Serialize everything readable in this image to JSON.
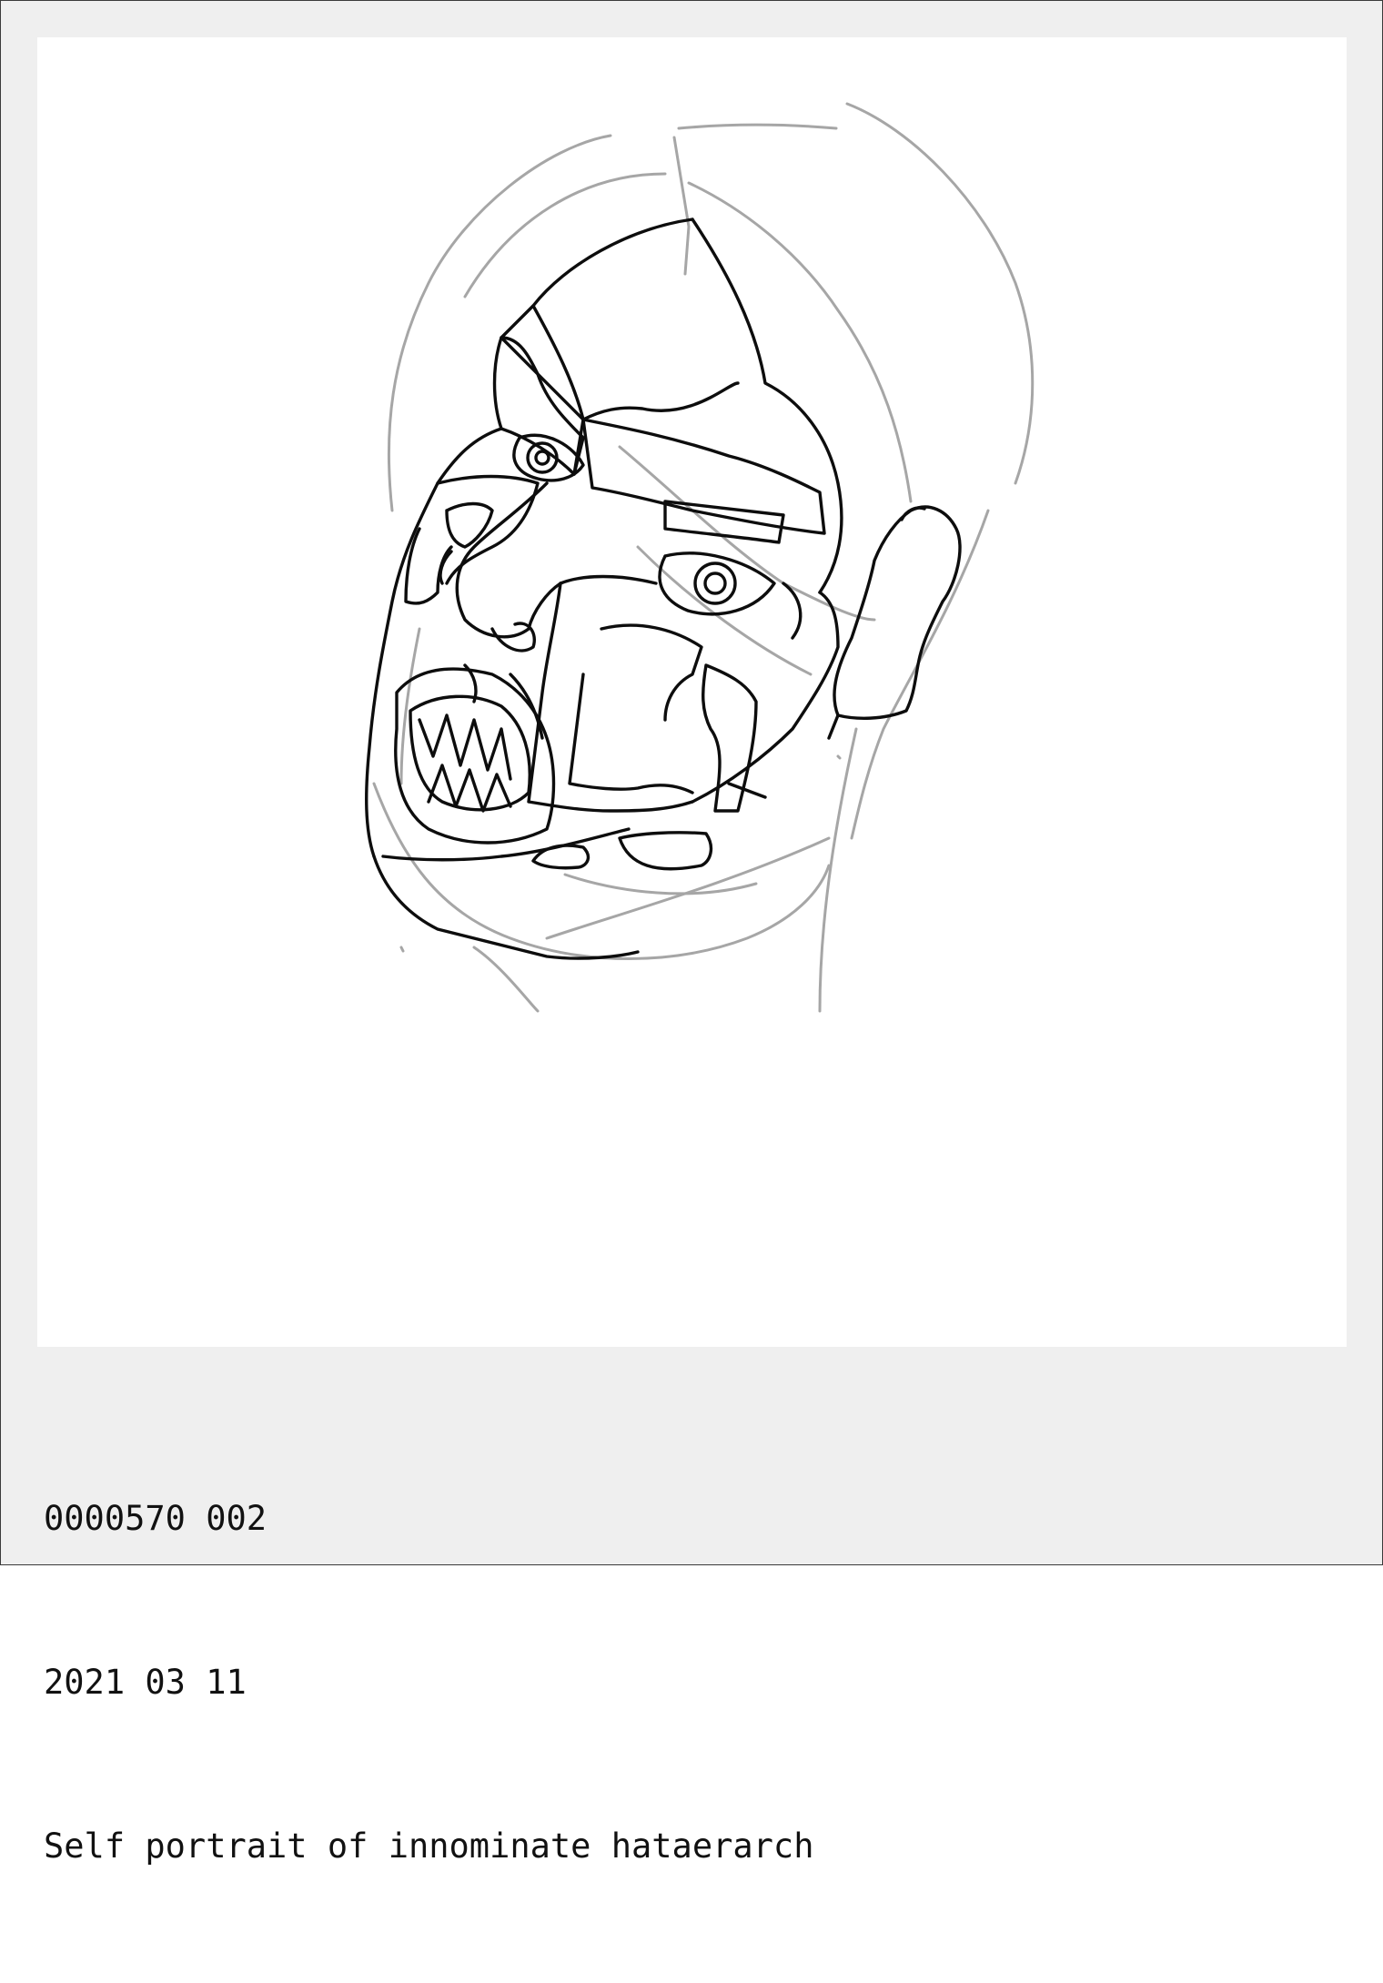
{
  "caption": {
    "line1": "0000570 002",
    "line2": "2021 03 11",
    "line3": "Self portrait of innominate hataerarch"
  },
  "artwork": {
    "subject": "line-drawing-face-icon",
    "ink_color": "#0d0d0d",
    "guide_color": "#a6a6a6",
    "paper_color": "#ffffff",
    "frame_color": "#efefef"
  }
}
